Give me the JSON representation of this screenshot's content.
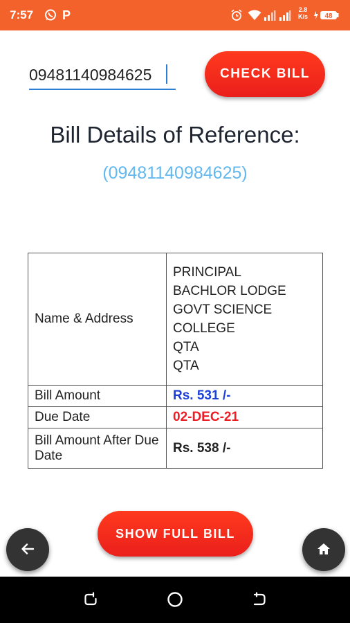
{
  "status_bar": {
    "time": "7:57",
    "paytm_letter": "P",
    "net_speed_value": "2.8",
    "net_speed_unit": "K/s",
    "battery_level": "48",
    "color": "#f4622c"
  },
  "search": {
    "reference_value": "09481140984625",
    "check_button_label": "CHECK BILL"
  },
  "heading": {
    "title": "Bill Details of Reference:",
    "reference_display": "(09481140984625)"
  },
  "bill_table": {
    "name_label": "Name & Address",
    "address_lines": [
      "PRINCIPAL",
      "BACHLOR LODGE",
      "GOVT SCIENCE",
      "COLLEGE",
      "QTA",
      "QTA"
    ],
    "amount_label": "Bill Amount",
    "amount_value": "Rs. 531 /-",
    "due_label": "Due Date",
    "due_value": "02-DEC-21",
    "after_label": "Bill Amount After Due Date",
    "after_value": "Rs. 538 /-"
  },
  "actions": {
    "full_bill_label": "SHOW FULL BILL"
  },
  "icons": {
    "fab_left": "arrow-left-icon",
    "fab_right": "home-icon"
  },
  "colors": {
    "accent_button": "#ee2a1c",
    "amount": "#1c3fd8",
    "due_date": "#ee1c24",
    "reference_link": "#63b8ee"
  }
}
